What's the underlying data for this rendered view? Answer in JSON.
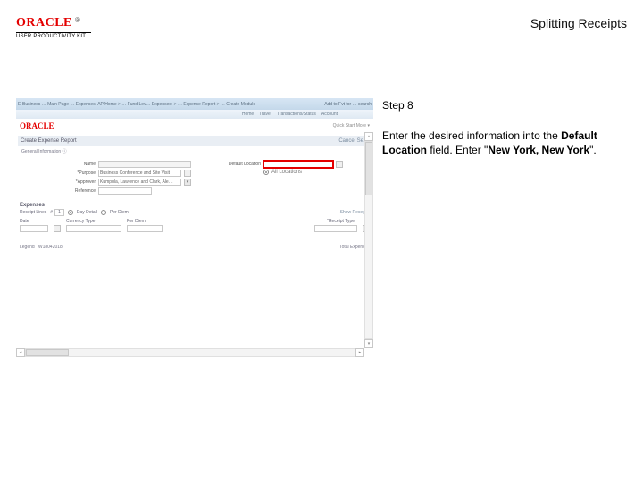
{
  "header": {
    "brand": "ORACLE",
    "tm": "®",
    "product_line": "USER PRODUCTIVITY KIT",
    "title": "Splitting Receipts"
  },
  "step": {
    "label": "Step 8"
  },
  "instruction": {
    "pre": "Enter the desired information into the ",
    "field_name": "Default Location",
    "mid": " field. Enter \"",
    "value": "New York, New York",
    "post": "\"."
  },
  "shot": {
    "breadcrumb": "E-Business … Main Page … Expenses: AP/Home > … Fund Lev… Expenses: > … Expense Report > … Create Module",
    "topRight": "Add to Fvt for …   search",
    "tabs": [
      "Home",
      "Travel",
      "Transactions/Status",
      "Account"
    ],
    "brand": "ORACLE",
    "brandRight": "Quick Start    More ▾",
    "sectionTitle": "Create Expense Report",
    "cancel": "Cancel   Se…",
    "sectionSub": "General Information  ⓘ",
    "nameLabel": "Name",
    "purposeLabel": "*Purpose",
    "purposeValue": "Business Conference and Site Visit",
    "approverLabel": "*Approver",
    "approverValue": "Kumpula, Lawrence and Clark, Ale…",
    "referenceLabel": "Reference",
    "defaultLabel": "Default Location",
    "radioLabel": "All Locations",
    "expensesTitle": "Expenses",
    "receiptLines": "Receipt Lines",
    "countPrefix": "#",
    "countValue": "1",
    "dayLabel": "Day Detail",
    "perPersonLabel": "Per Diem",
    "showReceipts": "Show Receipts",
    "thDate": "Date",
    "thCurr": "Currency Type",
    "thPer": "Per Diem",
    "thRecpt": "*Receipt Type",
    "legendLabel": "Legend",
    "legendDate": "W18042018",
    "legendRight": "Total Expenses"
  }
}
